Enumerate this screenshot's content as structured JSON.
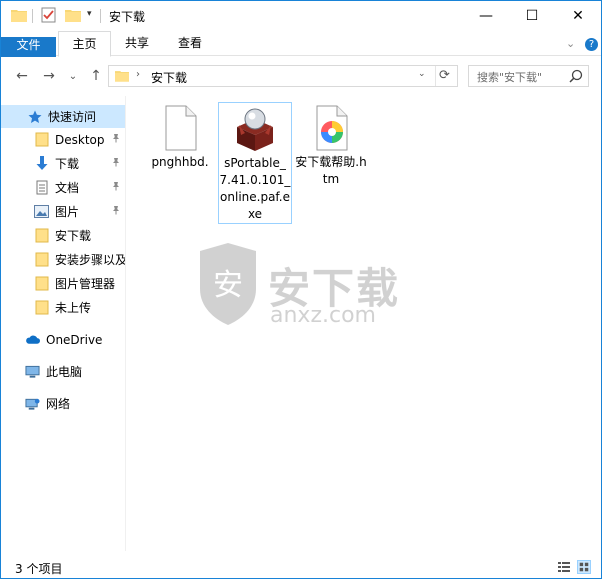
{
  "titlebar": {
    "title": "安下载",
    "qat_arrow": "▾",
    "minimize": "—",
    "maximize": "☐",
    "close": "✕"
  },
  "ribbon": {
    "tabs": [
      {
        "label": "文件"
      },
      {
        "label": "主页"
      },
      {
        "label": "共享"
      },
      {
        "label": "查看"
      }
    ],
    "expand_icon": "⌄",
    "help_icon": "?"
  },
  "nav": {
    "back": "←",
    "forward": "→",
    "recent": "⌄",
    "up": "↑"
  },
  "address": {
    "path": "安下载",
    "chevron": "›",
    "dropdown": "⌄",
    "refresh": "⟳"
  },
  "search": {
    "placeholder": "搜索\"安下载\""
  },
  "navpane": {
    "quick_access": "快速访问",
    "items": [
      {
        "label": "Desktop",
        "icon": "folder-icon",
        "pinned": true
      },
      {
        "label": "下载",
        "icon": "download-icon",
        "pinned": true
      },
      {
        "label": "文档",
        "icon": "document-icon",
        "pinned": true
      },
      {
        "label": "图片",
        "icon": "picture-icon",
        "pinned": true
      },
      {
        "label": "安下载",
        "icon": "folder-icon",
        "pinned": false
      },
      {
        "label": "安装步骤以及",
        "icon": "folder-icon",
        "pinned": false
      },
      {
        "label": "图片管理器",
        "icon": "folder-icon",
        "pinned": false
      },
      {
        "label": "未上传",
        "icon": "folder-icon",
        "pinned": false
      }
    ],
    "onedrive": "OneDrive",
    "this_pc": "此电脑",
    "network": "网络",
    "pin_glyph": "📌"
  },
  "files": [
    {
      "label": "pnghhbd.",
      "icon": "blank-file-icon"
    },
    {
      "label": "sPortable_7.41.0.101_online.paf.exe",
      "icon": "installer-box-icon"
    },
    {
      "label": "安下载帮助.htm",
      "icon": "browser-file-icon"
    }
  ],
  "watermark": {
    "cn": "安下载",
    "en": "anxz.com",
    "shield_char": "安"
  },
  "status": {
    "count": "3 个项目"
  },
  "colors": {
    "accent": "#1979ca",
    "selection": "#cce8ff",
    "border": "#1883d7"
  }
}
